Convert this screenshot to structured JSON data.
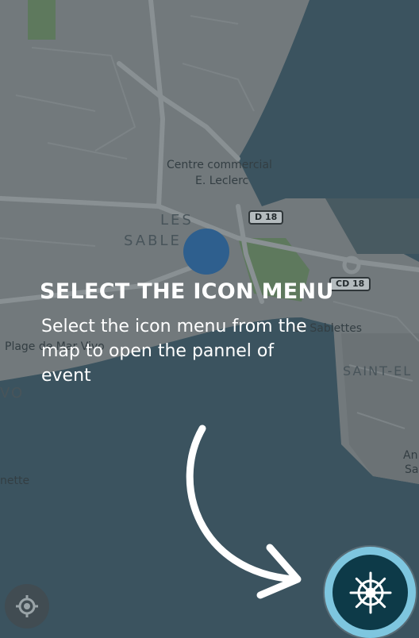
{
  "map": {
    "labels": {
      "centre_commercial_1": "Centre commercial",
      "centre_commercial_2": "E. Leclerc",
      "les": "LES",
      "sable": "SABLE",
      "d18": "D 18",
      "cd18": "CD 18",
      "plage": "Plage de Mar Vivo",
      "sablettes": "es Sablettes",
      "saint_el": "SAINT-EL",
      "vo": "VO",
      "nette": "nette",
      "an": "An",
      "sa": "Sa"
    },
    "colors": {
      "land": "#9a9a9a",
      "sea": "#45606d",
      "park": "#7b9a6a",
      "road": "#bdbdbd"
    }
  },
  "tutorial": {
    "title": "SELECT THE ICON MENU",
    "description": "Select the icon menu from the map to open the pannel of event"
  },
  "controls": {
    "menu_icon": "ship-wheel-icon",
    "locate_icon": "crosshair-icon",
    "accent_color": "#7ec6df"
  }
}
